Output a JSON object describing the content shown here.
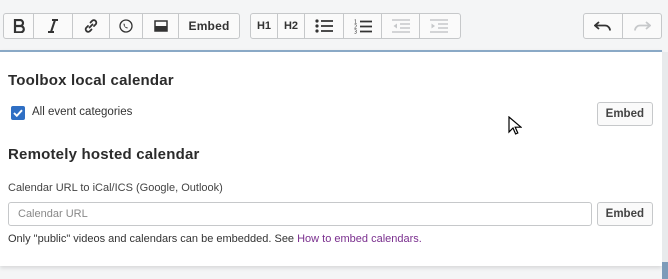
{
  "toolbar": {
    "embed_label": "Embed",
    "h1_label": "H1",
    "h2_label": "H2",
    "icons": [
      "bold-icon",
      "italic-icon",
      "link-icon",
      "phone-icon",
      "image-icon",
      "bulleted-list-icon",
      "numbered-list-icon",
      "outdent-icon",
      "indent-icon",
      "undo-icon",
      "redo-icon"
    ]
  },
  "local": {
    "title": "Toolbox local calendar",
    "checkbox_label": "All event categories",
    "checkbox_checked": true,
    "embed_label": "Embed"
  },
  "remote": {
    "title": "Remotely hosted calendar",
    "url_label": "Calendar URL to iCal/ICS (Google, Outlook)",
    "url_placeholder": "Calendar URL",
    "url_value": "",
    "embed_label": "Embed",
    "help_text": "Only \"public\" videos and calendars can be embedded. See ",
    "help_link": "How to embed calendars."
  },
  "colors": {
    "accent": "#2f6fc4",
    "link": "#7a2f8e",
    "panel_border": "#8aa9c6"
  }
}
